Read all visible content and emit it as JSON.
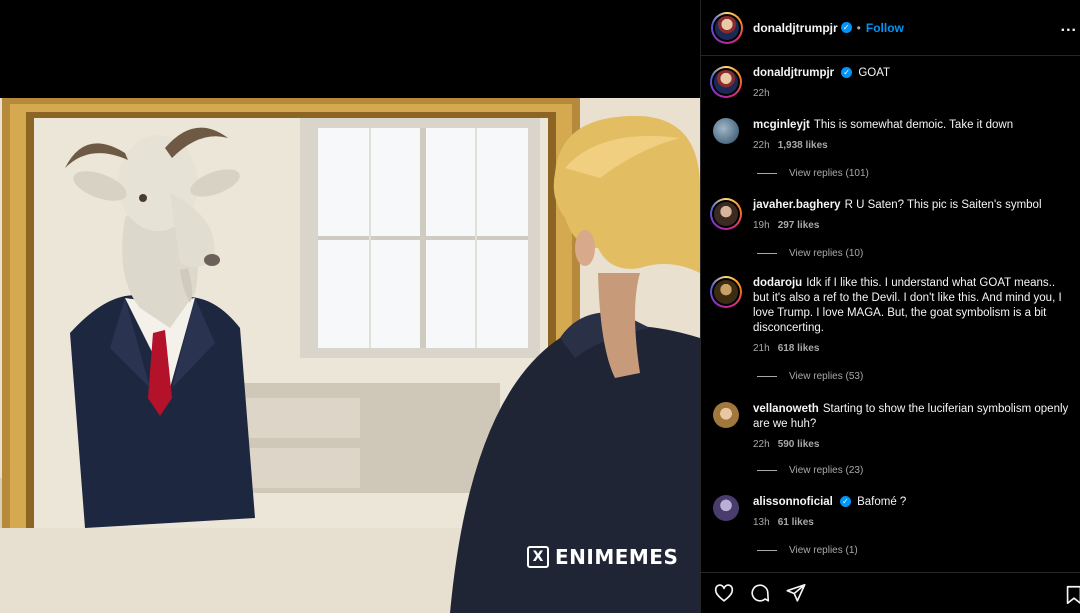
{
  "post": {
    "author": "donaldjtrumpjr",
    "follow_label": "Follow",
    "separator": "•",
    "more_label": "...",
    "caption": "GOAT",
    "caption_time": "22h",
    "watermark": "ENIMEMES",
    "watermark_logo": "X"
  },
  "comments": [
    {
      "user": "mcginleyjt",
      "text": "This is somewhat demoic. Take it down",
      "time": "22h",
      "likes": "1,938 likes",
      "replies": "View replies (101)",
      "verified": false
    },
    {
      "user": "javaher.baghery",
      "text": "R U Saten? This pic is Saiten's symbol",
      "time": "19h",
      "likes": "297 likes",
      "replies": "View replies (10)",
      "verified": false
    },
    {
      "user": "dodaroju",
      "text": "Idk if I like this. I understand what GOAT means.. but it's also a ref to the Devil. I don't like this. And mind you, I love Trump. I love MAGA. But, the goat symbolism is a bit disconcerting.",
      "time": "21h",
      "likes": "618 likes",
      "replies": "View replies (53)",
      "verified": false
    },
    {
      "user": "vellanoweth",
      "text": "Starting to show the luciferian symbolism openly are we huh?",
      "time": "22h",
      "likes": "590 likes",
      "replies": "View replies (23)",
      "verified": false
    },
    {
      "user": "alissonnoficial",
      "text": "Bafomé ?",
      "time": "13h",
      "likes": "61 likes",
      "replies": "View replies (1)",
      "verified": true
    }
  ],
  "colors": {
    "accent": "#0095f6",
    "background": "#000000",
    "muted_text": "#a8a8a8",
    "divider": "#262626"
  },
  "icons": [
    "heart-icon",
    "comment-icon",
    "share-icon",
    "bookmark-icon",
    "verified-icon",
    "more-options-icon"
  ]
}
